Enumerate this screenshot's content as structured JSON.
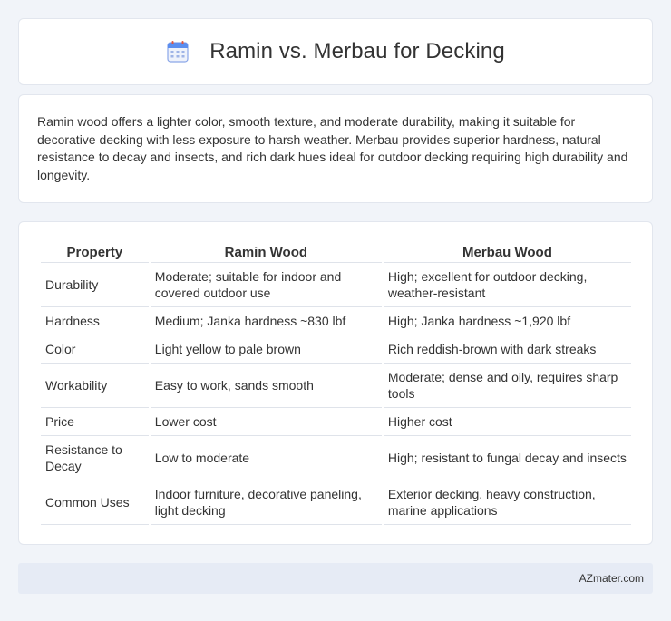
{
  "header": {
    "title": "Ramin vs. Merbau for Decking",
    "icon": "calendar-icon",
    "icon_color": "#5b8def"
  },
  "intro": {
    "text": "Ramin wood offers a lighter color, smooth texture, and moderate durability, making it suitable for decorative decking with less exposure to harsh weather. Merbau provides superior hardness, natural resistance to decay and insects, and rich dark hues ideal for outdoor decking requiring high durability and longevity."
  },
  "table": {
    "headers": [
      "Property",
      "Ramin Wood",
      "Merbau Wood"
    ],
    "rows": [
      {
        "property": "Durability",
        "ramin": "Moderate; suitable for indoor and covered outdoor use",
        "merbau": "High; excellent for outdoor decking, weather-resistant"
      },
      {
        "property": "Hardness",
        "ramin": "Medium; Janka hardness ~830 lbf",
        "merbau": "High; Janka hardness ~1,920 lbf"
      },
      {
        "property": "Color",
        "ramin": "Light yellow to pale brown",
        "merbau": "Rich reddish-brown with dark streaks"
      },
      {
        "property": "Workability",
        "ramin": "Easy to work, sands smooth",
        "merbau": "Moderate; dense and oily, requires sharp tools"
      },
      {
        "property": "Price",
        "ramin": "Lower cost",
        "merbau": "Higher cost"
      },
      {
        "property": "Resistance to Decay",
        "ramin": "Low to moderate",
        "merbau": "High; resistant to fungal decay and insects"
      },
      {
        "property": "Common Uses",
        "ramin": "Indoor furniture, decorative paneling, light decking",
        "merbau": "Exterior decking, heavy construction, marine applications"
      }
    ]
  },
  "footer": {
    "text": "AZmater.com"
  }
}
